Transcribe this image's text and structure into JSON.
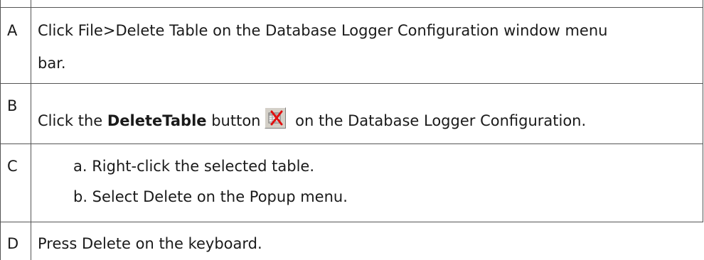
{
  "rows": [
    {
      "letter": "A",
      "lines": [
        "Click File>Delete Table on the Database Logger Configuration window menu",
        "bar."
      ]
    },
    {
      "letter": "B",
      "prefix": "Click the ",
      "bold": "DeleteTable",
      "middle": " button",
      "suffix": " on the Database Logger Configuration.",
      "icon": "delete-table-icon"
    },
    {
      "letter": "C",
      "items": [
        "a. Right-click the selected table.",
        "b. Select Delete on the Popup menu."
      ]
    },
    {
      "letter": "D",
      "lines": [
        "Press Delete on the keyboard."
      ]
    }
  ]
}
